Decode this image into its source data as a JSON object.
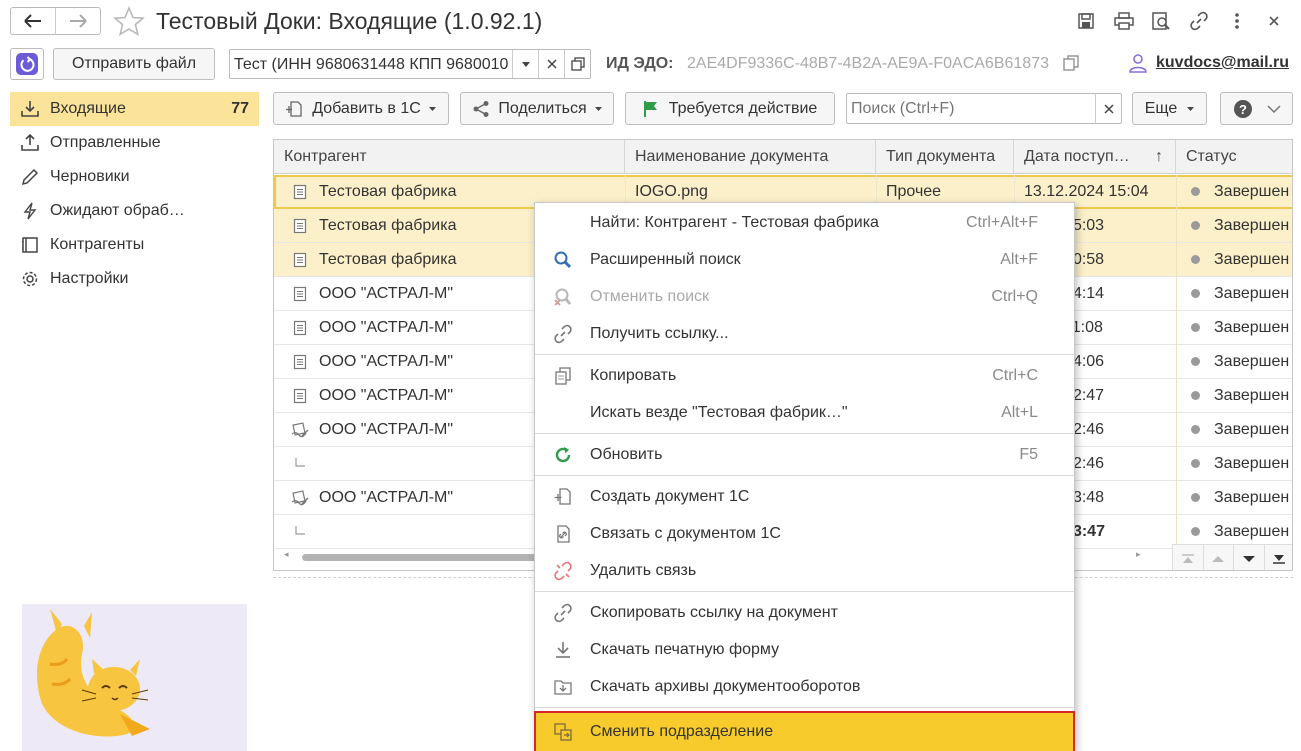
{
  "window": {
    "title": "Тестовый Доки: Входящие (1.0.92.1)",
    "nav_back_icon": "arrow-left-icon",
    "nav_forward_icon": "arrow-right-icon",
    "favorite_icon": "star-icon"
  },
  "header": {
    "send_file_label": "Отправить файл",
    "org_select_value": "Тест (ИНН 9680631448 КПП 9680010",
    "edo_label": "ИД ЭДО:",
    "edo_id": "2AE4DF9336C-48B7-4B2A-AE9A-F0ACA6B61873",
    "user_email": "kuvdocs@mail.ru"
  },
  "sidebar": {
    "items": [
      {
        "label": "Входящие",
        "count": "77",
        "icon": "inbox-download-icon"
      },
      {
        "label": "Отправленные",
        "icon": "outbox-upload-icon"
      },
      {
        "label": "Черновики",
        "icon": "pencil-icon"
      },
      {
        "label": "Ожидают обраб…",
        "icon": "lightning-icon"
      },
      {
        "label": "Контрагенты",
        "icon": "contacts-icon"
      },
      {
        "label": "Настройки",
        "icon": "gear-icon"
      }
    ]
  },
  "toolbar": {
    "add_1c_label": "Добавить в 1С",
    "share_label": "Поделиться",
    "action_required_label": "Требуется действие",
    "search_placeholder": "Поиск (Ctrl+F)",
    "more_label": "Еще",
    "help_icon": "question-icon"
  },
  "table": {
    "columns": [
      "Контрагент",
      "Наименование документа",
      "Тип документа",
      "Дата поступ…",
      "Статус"
    ],
    "rows": [
      {
        "contractor": "Тестовая фабрика",
        "doc": "IOGO.png",
        "type": "Прочее",
        "date": "13.12.2024 15:04",
        "status": "Завершен",
        "icon": "document-icon",
        "selected": true
      },
      {
        "contractor": "Тестовая фабрика",
        "doc": "",
        "type": "",
        "date": "2024 15:03",
        "status": "Завершен",
        "icon": "document-icon",
        "selected": true
      },
      {
        "contractor": "Тестовая фабрика",
        "doc": "",
        "type": "",
        "date": "2024 10:58",
        "status": "Завершен",
        "icon": "document-icon",
        "selected": true
      },
      {
        "contractor": "ООО \"АСТРАЛ-М\"",
        "doc": "",
        "type": "",
        "date": "2024 14:14",
        "status": "Завершен",
        "icon": "document-icon"
      },
      {
        "contractor": "ООО \"АСТРАЛ-М\"",
        "doc": "",
        "type": "",
        "date": "2024 11:08",
        "status": "Завершен",
        "icon": "document-icon"
      },
      {
        "contractor": "ООО \"АСТРАЛ-М\"",
        "doc": "",
        "type": "",
        "date": "2024 14:06",
        "status": "Завершен",
        "icon": "document-icon"
      },
      {
        "contractor": "ООО \"АСТРАЛ-М\"",
        "doc": "",
        "type": "",
        "date": "2024 12:47",
        "status": "Завершен",
        "icon": "document-icon"
      },
      {
        "contractor": "ООО \"АСТРАЛ-М\"",
        "doc": "",
        "type": "",
        "date": "2024 12:46",
        "status": "Завершен",
        "icon": "signed-document-icon"
      },
      {
        "contractor": "",
        "doc": "",
        "type": "",
        "date": "2024 12:46",
        "status": "Завершен",
        "icon": "tree-child-icon"
      },
      {
        "contractor": "ООО \"АСТРАЛ-М\"",
        "doc": "",
        "type": "",
        "date": "2024 13:48",
        "status": "Завершен",
        "icon": "signed-document-icon"
      },
      {
        "contractor": "",
        "doc": "",
        "type": "",
        "date": "2024 13:47",
        "status": "Завершен",
        "icon": "tree-child-icon",
        "bold_date": true
      }
    ]
  },
  "context_menu": {
    "items": [
      {
        "label": "Найти: Контрагент - Тестовая фабрика",
        "shortcut": "Ctrl+Alt+F",
        "icon": "none"
      },
      {
        "label": "Расширенный поиск",
        "shortcut": "Alt+F",
        "icon": "magnifier-icon"
      },
      {
        "label": "Отменить поиск",
        "shortcut": "Ctrl+Q",
        "icon": "cancel-search-icon",
        "disabled": true
      },
      {
        "label": "Получить ссылку...",
        "shortcut": "",
        "icon": "link-icon"
      },
      {
        "label": "Копировать",
        "shortcut": "Ctrl+C",
        "icon": "copy-icon"
      },
      {
        "label": "Искать везде \"Тестовая фабрик…\"",
        "shortcut": "Alt+L",
        "icon": "none"
      },
      {
        "label": "Обновить",
        "shortcut": "F5",
        "icon": "refresh-icon"
      },
      {
        "label": "Создать документ 1С",
        "shortcut": "",
        "icon": "create-document-icon"
      },
      {
        "label": "Связать с документом 1С",
        "shortcut": "",
        "icon": "link-document-icon"
      },
      {
        "label": "Удалить связь",
        "shortcut": "",
        "icon": "unlink-icon"
      },
      {
        "label": "Скопировать ссылку на документ",
        "shortcut": "",
        "icon": "link-icon"
      },
      {
        "label": "Скачать печатную форму",
        "shortcut": "",
        "icon": "download-icon"
      },
      {
        "label": "Скачать архивы документооборотов",
        "shortcut": "",
        "icon": "archive-download-icon"
      },
      {
        "label": "Сменить подразделение",
        "shortcut": "",
        "icon": "change-department-icon",
        "highlighted": true
      }
    ]
  },
  "colors": {
    "accent_yellow": "#f8cb2c",
    "selection": "#fbf0c9",
    "sidebar_active": "#fbe49a",
    "highlight_border": "#d62828",
    "app_icon": "#6b5bd6"
  }
}
